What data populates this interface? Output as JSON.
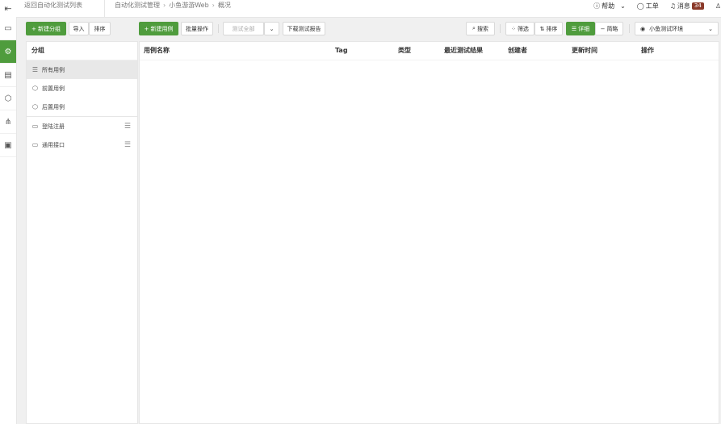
{
  "topbar": {
    "back_label": "返回自动化测试列表",
    "breadcrumb": [
      "自动化测试管理",
      "小鱼游游Web",
      "概况"
    ],
    "help": "帮助",
    "ticket": "工单",
    "messages": "消息",
    "message_count": "34"
  },
  "toolbar": {
    "new_group": "+ 新建分组",
    "import": "导入",
    "sort_groups": "排序",
    "new_case": "+ 新建用例",
    "batch": "批量操作",
    "test_all": "测试全部",
    "download_report": "下载测试报告",
    "search": "搜索",
    "filter": "筛选",
    "sort": "排序",
    "detail": "详细",
    "brief": "简略",
    "environment": "小鱼测试环境"
  },
  "groups": {
    "header": "分组",
    "items": [
      {
        "label": "所有用例"
      },
      {
        "label": "前置用例"
      },
      {
        "label": "后置用例"
      },
      {
        "label": "登陆注册"
      },
      {
        "label": "通用接口"
      }
    ]
  },
  "table": {
    "columns": [
      "用例名称",
      "Tag",
      "类型",
      "最近测试结果",
      "创建者",
      "更新时间",
      "操作"
    ]
  },
  "colors": {
    "accent": "#4f9c3d",
    "badge": "#8b3a2a"
  }
}
